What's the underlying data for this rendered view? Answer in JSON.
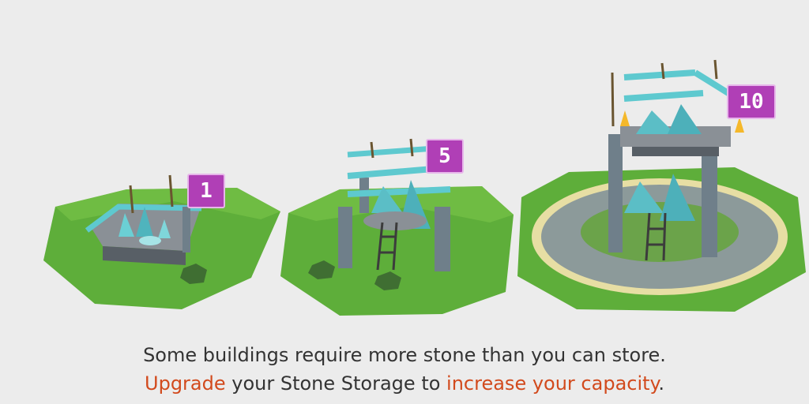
{
  "levels": [
    {
      "label": "1"
    },
    {
      "label": "5"
    },
    {
      "label": "10"
    }
  ],
  "caption": {
    "line1": "Some buildings require more stone than you can store.",
    "line2_highlight_1": "Upgrade",
    "line2_text_1": " your Stone Storage to ",
    "line2_highlight_2": "increase your capacity",
    "line2_text_2": "."
  },
  "colors": {
    "background": "#ececec",
    "grass": "#5fae3a",
    "stone": "#6f7f8a",
    "crystal": "#64c7cf",
    "flag": "#b03fb6",
    "highlight_text": "#d24a1d"
  }
}
